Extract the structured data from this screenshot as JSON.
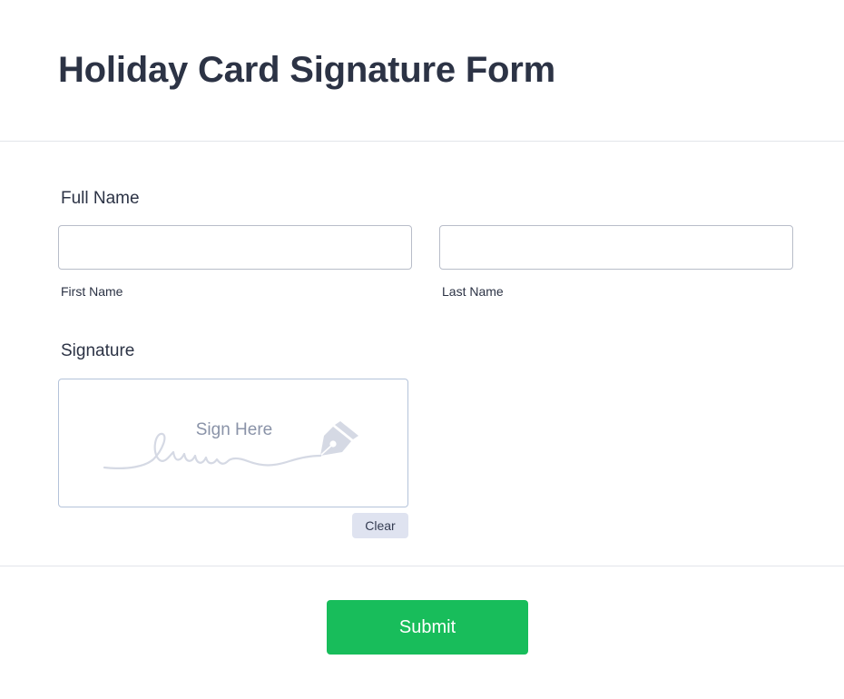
{
  "form": {
    "title": "Holiday Card Signature Form"
  },
  "full_name": {
    "label": "Full Name",
    "first": {
      "value": "",
      "placeholder": "",
      "sublabel": "First Name"
    },
    "last": {
      "value": "",
      "placeholder": "",
      "sublabel": "Last Name"
    }
  },
  "signature": {
    "label": "Signature",
    "placeholder_text": "Sign Here",
    "icon": "pen-nib-icon",
    "clear_label": "Clear"
  },
  "submit": {
    "label": "Submit"
  },
  "colors": {
    "accent_submit": "#18bd5b",
    "text_primary": "#2c3345",
    "clear_bg": "#dfe3f0",
    "signature_border": "#b4c3da"
  }
}
